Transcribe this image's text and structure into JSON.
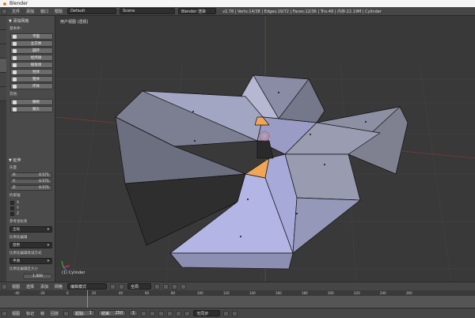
{
  "window": {
    "title": "Blender"
  },
  "info_bar": {
    "menus": [
      "文件",
      "添加",
      "窗口",
      "帮助"
    ],
    "layout": "Default",
    "scene": "Scene",
    "engine": "Blender 渲染",
    "stats": "v2.78 | Verts:14/38 | Edges:19/72 | Faces:12/36 | Tris:48 | 内存:22.19M | Cylinder"
  },
  "tool_shelf": {
    "title": "▼ 添加网格",
    "section_basic": "基本体:",
    "primitives": [
      "平面",
      "立方体",
      "圆环",
      "经纬球",
      "棱角球",
      "柱体",
      "锥体",
      "环体"
    ],
    "section_other": "其他:",
    "others": [
      "栅格",
      "猴头"
    ]
  },
  "operator_panel": {
    "title": "▼ 延伸",
    "vector_label": "矢量",
    "vector": [
      {
        "axis": "X:",
        "value": "0.571"
      },
      {
        "axis": "Y:",
        "value": "0.571"
      },
      {
        "axis": "Z:",
        "value": "0.571"
      }
    ],
    "constraint_label": "约束轴",
    "axes": [
      "X",
      "Y",
      "Z"
    ],
    "orientation_label": "参考坐标系",
    "orientation": "全局",
    "proportional_label": "比例化编辑",
    "proportional": "禁用",
    "falloff_label": "比例化编辑衰减方式",
    "falloff": "平滑",
    "size_label": "比例化编辑区大小",
    "size": "1.000"
  },
  "viewport": {
    "view_label": "用户视图 (透视)",
    "object_label": "(1) Cylinder"
  },
  "view3d_header": {
    "menus": [
      "视图",
      "选择",
      "添加",
      "网格"
    ],
    "mode": "编辑模式",
    "pivot": "全局"
  },
  "timeline": {
    "ticks": [
      "-40",
      "-20",
      "0",
      "20",
      "40",
      "60",
      "80",
      "100",
      "120",
      "140",
      "160",
      "180",
      "200",
      "220",
      "240",
      "260"
    ],
    "current_frame": 1,
    "menus": [
      "视图",
      "标记",
      "帧",
      "回放"
    ],
    "start_label": "起始:",
    "start": "1",
    "end_label": "结束:",
    "end": "250",
    "frame": "1",
    "sync": "无同步"
  },
  "colors": {
    "face": "#9a9db8",
    "face_dark": "#8d8fa3",
    "face_light": "#b5b8e0",
    "selected": "#e8a060",
    "edge": "#111111"
  }
}
